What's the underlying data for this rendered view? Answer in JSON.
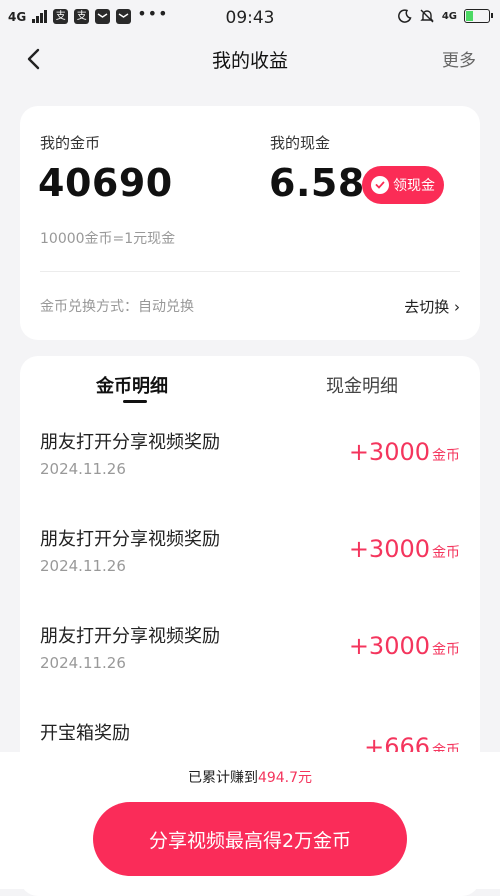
{
  "status_bar": {
    "network": "4G",
    "app_icon_1": "支",
    "app_icon_2": "支",
    "more": "•••",
    "time": "09:43",
    "network_right": "4G",
    "battery_level": 0.3,
    "icons": [
      "moon-icon",
      "mute-icon",
      "battery-icon"
    ]
  },
  "nav": {
    "title": "我的收益",
    "more": "更多"
  },
  "summary": {
    "coins_label": "我的金币",
    "coins_value": "40690",
    "cash_label": "我的现金",
    "cash_value": "6.58",
    "cash_button": "领现金",
    "rate": "10000金币=1元现金",
    "mode": "金币兑换方式：自动兑换",
    "switch": "去切换 ›"
  },
  "tabs": {
    "coins": "金币明细",
    "cash": "现金明细"
  },
  "records": [
    {
      "title": "朋友打开分享视频奖励",
      "date": "2024.11.26",
      "amount": "+3000",
      "unit": "金币"
    },
    {
      "title": "朋友打开分享视频奖励",
      "date": "2024.11.26",
      "amount": "+3000",
      "unit": "金币"
    },
    {
      "title": "朋友打开分享视频奖励",
      "date": "2024.11.26",
      "amount": "+3000",
      "unit": "金币"
    },
    {
      "title": "开宝箱奖励",
      "date": "",
      "amount": "+666",
      "unit": "金币"
    }
  ],
  "footer": {
    "total_prefix": "已累计赚到",
    "total_value": "494.7元",
    "share_button": "分享视频最高得2万金币"
  },
  "colors": {
    "accent": "#fb2c56",
    "amount": "#f4355d",
    "background": "#f4f4f6"
  }
}
